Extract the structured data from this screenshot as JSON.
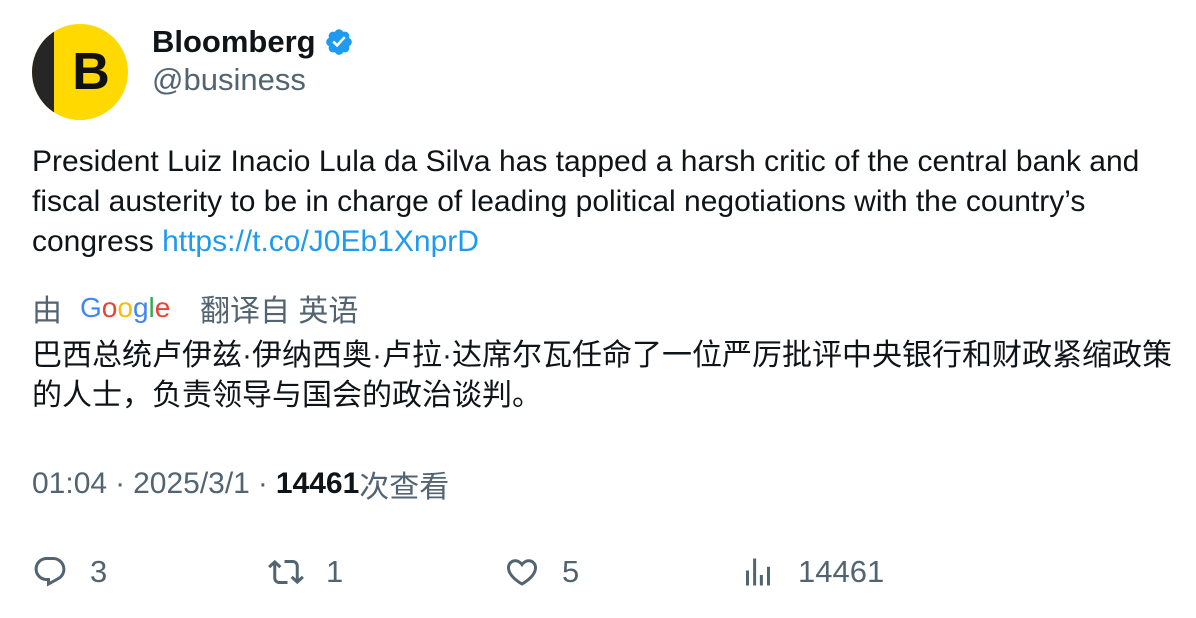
{
  "author": {
    "avatar_letter": "B",
    "display_name": "Bloomberg",
    "handle": "@business",
    "verified_icon": "verified-badge-icon",
    "brand_color": "#ffd900",
    "verified_color": "#1d9bf0"
  },
  "tweet": {
    "text": "President Luiz Inacio Lula da Silva has tapped a harsh critic of the central bank and fiscal austerity to be in charge of leading political negotiations with the country’s congress ",
    "link": "https://t.co/J0Eb1XnprD"
  },
  "translation": {
    "prefix": "由",
    "logo_text": "Google",
    "suffix": "翻译自 英语",
    "text": "巴西总统卢伊兹·伊纳西奥·卢拉·达席尔瓦任命了一位严厉批评中央银行和财政紧缩政策的人士，负责领导与国会的政治谈判。"
  },
  "meta": {
    "time": "01:04",
    "separator": "·",
    "date": "2025/3/1",
    "views_count": "14461",
    "views_label": "次查看"
  },
  "actions": {
    "replies": "3",
    "reposts": "1",
    "likes": "5",
    "views": "14461"
  },
  "colors": {
    "text": "#0f1419",
    "secondary": "#536471",
    "link": "#1d9bf0"
  }
}
